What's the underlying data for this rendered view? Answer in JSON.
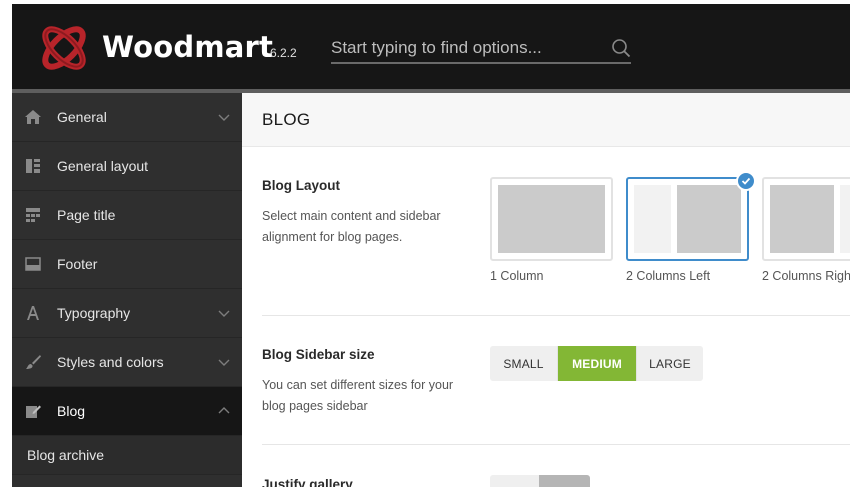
{
  "header": {
    "brand": "Woodmart",
    "version": "6.2.2",
    "search_placeholder": "Start typing to find options...",
    "logo_icon": "woodmart-logo-icon",
    "search_icon": "search-icon"
  },
  "sidebar": {
    "items": [
      {
        "label": "General",
        "icon": "home-icon",
        "expandable": true
      },
      {
        "label": "General layout",
        "icon": "layout-icon",
        "expandable": false
      },
      {
        "label": "Page title",
        "icon": "page-title-icon",
        "expandable": false
      },
      {
        "label": "Footer",
        "icon": "footer-icon",
        "expandable": false
      },
      {
        "label": "Typography",
        "icon": "typography-icon",
        "expandable": true
      },
      {
        "label": "Styles and colors",
        "icon": "brush-icon",
        "expandable": true
      },
      {
        "label": "Blog",
        "icon": "edit-icon",
        "expandable": true,
        "active": true
      }
    ],
    "subitems": [
      {
        "label": "Blog archive"
      }
    ]
  },
  "main": {
    "section_title": "BLOG",
    "blog_layout": {
      "title": "Blog Layout",
      "description": "Select main content and sidebar alignment for blog pages.",
      "options": [
        {
          "label": "1 Column",
          "selected": false
        },
        {
          "label": "2 Columns Left",
          "selected": true
        },
        {
          "label": "2 Columns Righ",
          "selected": false
        }
      ]
    },
    "sidebar_size": {
      "title": "Blog Sidebar size",
      "description": "You can set different sizes for your blog pages sidebar",
      "options": [
        {
          "label": "SMALL",
          "selected": false
        },
        {
          "label": "MEDIUM",
          "selected": true
        },
        {
          "label": "LARGE",
          "selected": false
        }
      ]
    },
    "justify_gallery": {
      "title": "Justify gallery"
    }
  },
  "colors": {
    "header_bg": "#161616",
    "sidebar_bg": "#2f2f2f",
    "accent_green": "#83b735",
    "accent_blue": "#3f8ccb",
    "logo_red": "#c0262c"
  }
}
